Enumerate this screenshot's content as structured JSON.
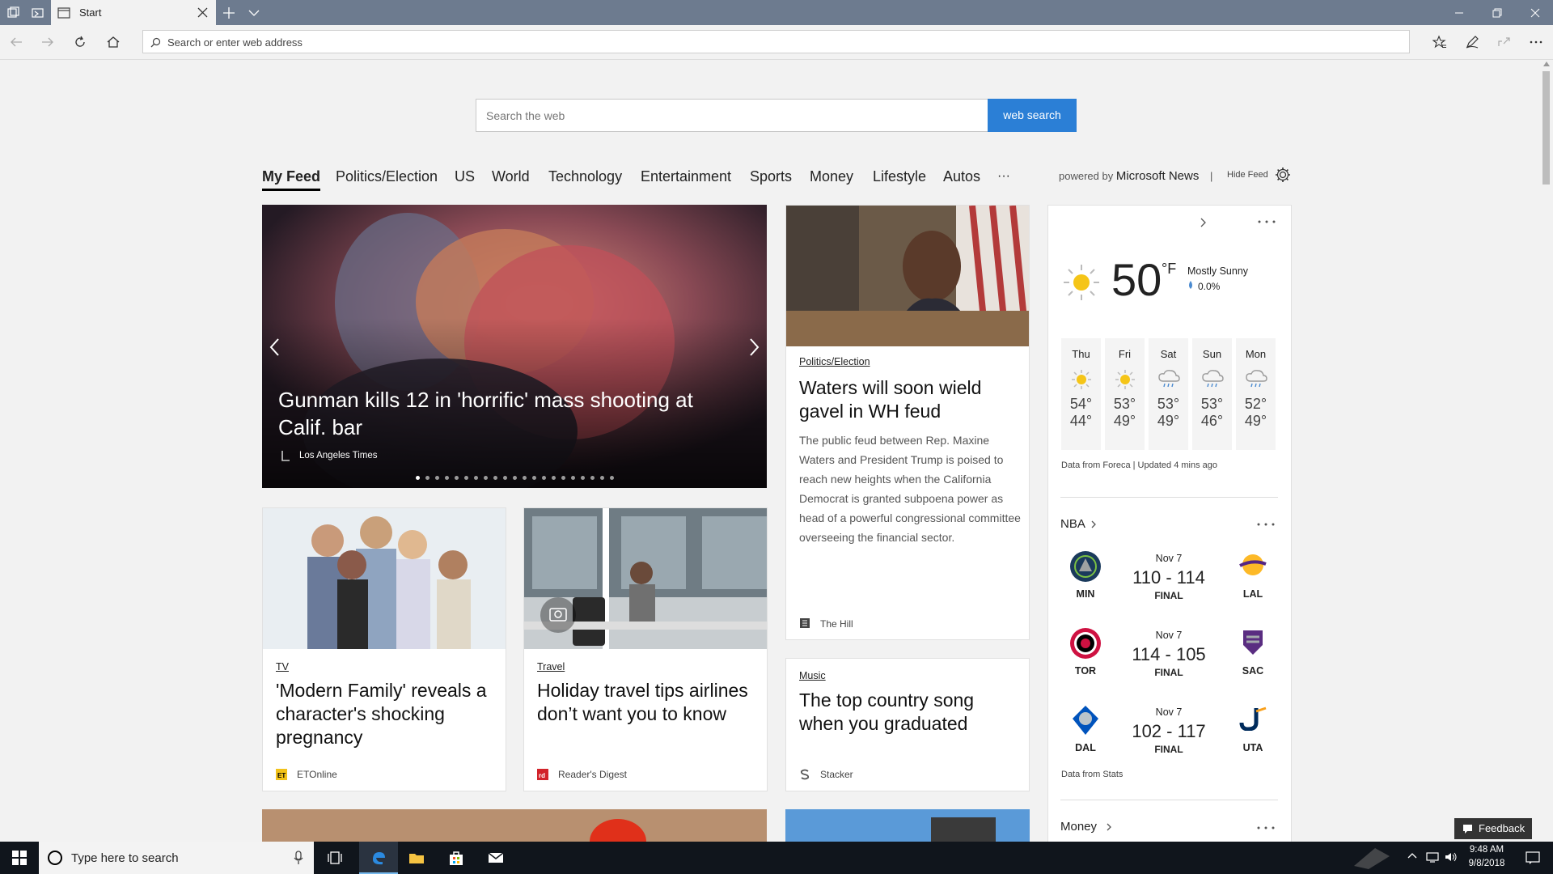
{
  "browser": {
    "tab_title": "Start",
    "address_placeholder": "Search or enter web address"
  },
  "search": {
    "placeholder": "Search the web",
    "button_label": "web search"
  },
  "feed_nav": {
    "tabs": [
      "My Feed",
      "Politics/Election",
      "US",
      "World",
      "Technology",
      "Entertainment",
      "Sports",
      "Money",
      "Lifestyle",
      "Autos",
      "···"
    ],
    "active_tab": "My Feed",
    "powered_by_prefix": "powered by",
    "powered_by_brand": "Microsoft News",
    "separator": "|",
    "hide_feed": "Hide Feed"
  },
  "hero": {
    "headline": "Gunman kills 12 in 'horrific' mass shooting at Calif. bar",
    "source": "Los Angeles Times",
    "slide_count": 21,
    "active_slide": 1
  },
  "articles": [
    {
      "category": "Politics/Election",
      "headline": "Waters will soon wield gavel in WH feud",
      "summary": "The public feud between Rep. Maxine Waters and President Trump is poised to reach new heights when the California Democrat is granted subpoena power as head of a powerful congressional committee overseeing the financial sector.",
      "source": "The Hill"
    },
    {
      "category": "TV",
      "headline": "'Modern Family' reveals a character's shocking pregnancy",
      "source": "ETOnline"
    },
    {
      "category": "Travel",
      "headline": "Holiday travel tips airlines don’t want you to know",
      "source": "Reader's Digest"
    },
    {
      "category": "Music",
      "headline": "The top country song when you graduated",
      "source": "Stacker"
    }
  ],
  "weather": {
    "temperature": "50",
    "unit": "°F",
    "condition": "Mostly Sunny",
    "precipitation": "0.0%",
    "forecast": [
      {
        "day": "Thu",
        "high": "54°",
        "low": "44°",
        "icon": "sun-icon"
      },
      {
        "day": "Fri",
        "high": "53°",
        "low": "49°",
        "icon": "sun-icon"
      },
      {
        "day": "Sat",
        "high": "53°",
        "low": "49°",
        "icon": "rain-cloud-icon"
      },
      {
        "day": "Sun",
        "high": "53°",
        "low": "46°",
        "icon": "rain-cloud-icon"
      },
      {
        "day": "Mon",
        "high": "52°",
        "low": "49°",
        "icon": "rain-cloud-icon"
      }
    ],
    "attribution": "Data from Foreca | Updated 4 mins ago"
  },
  "nba": {
    "title": "NBA",
    "games": [
      {
        "date": "Nov 7",
        "home": "MIN",
        "away": "LAL",
        "score": "110 - 114",
        "status": "FINAL"
      },
      {
        "date": "Nov 7",
        "home": "TOR",
        "away": "SAC",
        "score": "114 - 105",
        "status": "FINAL"
      },
      {
        "date": "Nov 7",
        "home": "DAL",
        "away": "UTA",
        "score": "102 - 117",
        "status": "FINAL"
      }
    ],
    "attribution": "Data from Stats"
  },
  "money": {
    "title": "Money"
  },
  "feedback": {
    "label": "Feedback"
  },
  "taskbar": {
    "search_placeholder": "Type here to search",
    "time": "9:48 AM",
    "date": "9/8/2018"
  },
  "colors": {
    "titlebar": "#6d7b8f",
    "accent": "#2b7fd6",
    "taskbar": "#10151c"
  }
}
